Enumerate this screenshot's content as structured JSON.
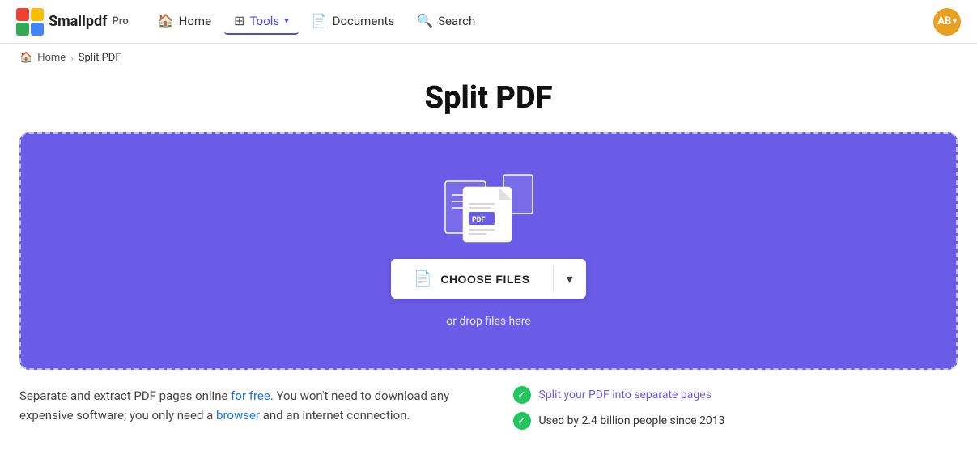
{
  "navbar": {
    "logo_text": "Smallpdf",
    "logo_pro": "Pro",
    "nav_items": [
      {
        "id": "home",
        "label": "Home",
        "icon": "🏠",
        "active": false
      },
      {
        "id": "tools",
        "label": "Tools",
        "icon": "⊞",
        "active": true,
        "dropdown": true
      },
      {
        "id": "documents",
        "label": "Documents",
        "icon": "📄",
        "active": false
      },
      {
        "id": "search",
        "label": "Search",
        "icon": "🔍",
        "active": false
      }
    ],
    "avatar_initials": "AB"
  },
  "breadcrumb": {
    "home_label": "Home",
    "separator": "›",
    "current": "Split PDF"
  },
  "page": {
    "title": "Split PDF"
  },
  "dropzone": {
    "choose_files_label": "CHOOSE FILES",
    "drop_hint": "or drop files here"
  },
  "description": {
    "text_part1": "Separate and extract PDF pages online for free. You won't need to download any expensive software; you only need a browser and an internet connection."
  },
  "features": [
    {
      "id": "feature1",
      "text": "Split your PDF into separate pages"
    },
    {
      "id": "feature2",
      "text": "Used by 2.4 billion people since 2013"
    }
  ]
}
